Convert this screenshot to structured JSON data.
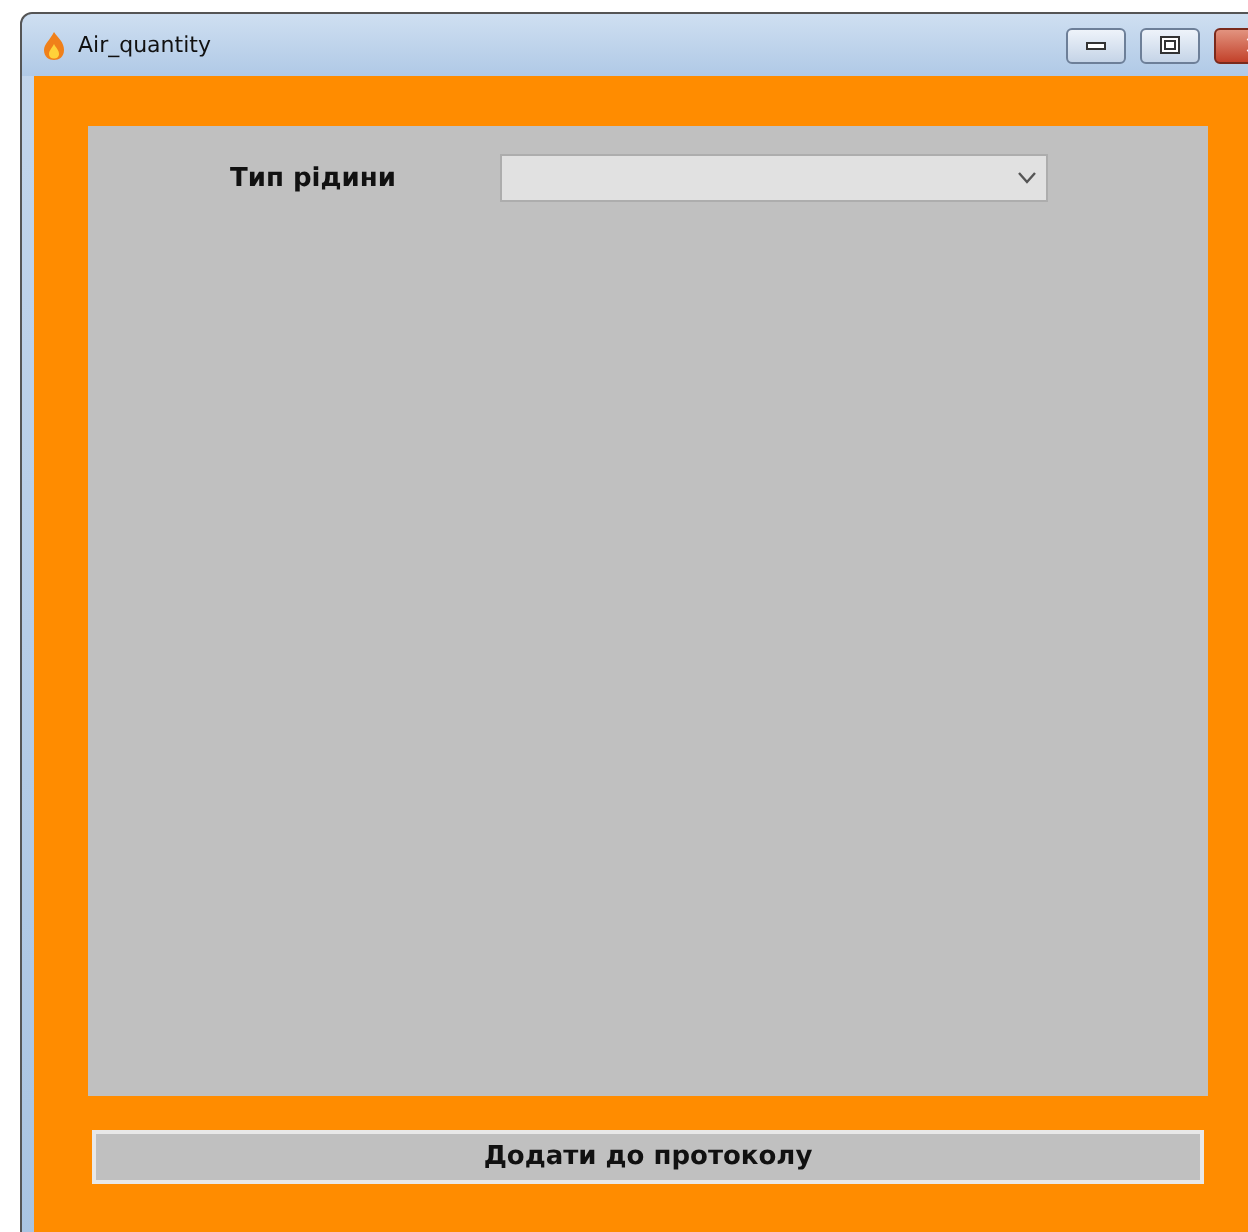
{
  "window": {
    "title": "Air_quantity"
  },
  "form": {
    "fluid_type_label": "Тип рідини"
  },
  "button": "Додати до протоколу"
}
